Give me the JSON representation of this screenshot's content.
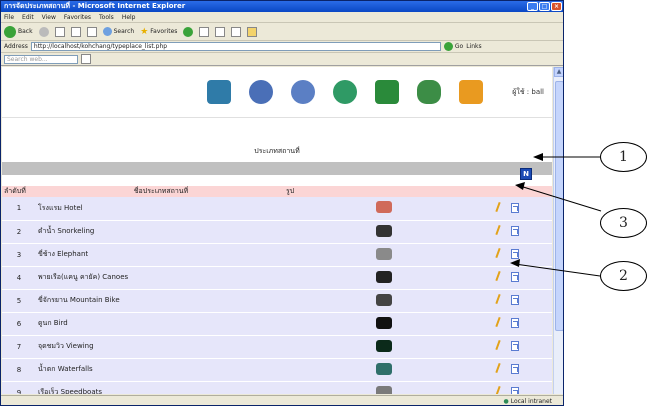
{
  "browser": {
    "title": "การจัดประเภทสถานที่ - Microsoft Internet Explorer",
    "menu": [
      "File",
      "Edit",
      "View",
      "Favorites",
      "Tools",
      "Help"
    ],
    "toolbar": {
      "back": "Back",
      "search": "Search",
      "favorites": "Favorites"
    },
    "address_label": "Address",
    "address": "http://localhost/kohchang/typeplace_list.php",
    "go_label": "Go",
    "links_label": "Links",
    "search_placeholder": "Search web...",
    "status_zone": "Local intranet"
  },
  "page": {
    "user_label": "ผู้ใช้ : ball",
    "heading": "ประเภทสถานที่",
    "new_button": "N",
    "columns": [
      "ลำดับที่",
      "ชื่อประเภทสถานที่",
      "รูป"
    ],
    "rows": [
      {
        "no": "1",
        "name": "โรงแรม Hotel",
        "img": "#d06a5a"
      },
      {
        "no": "2",
        "name": "ดำน้ำ Snorkeling",
        "img": "#333333"
      },
      {
        "no": "3",
        "name": "ขี่ช้าง Elephant",
        "img": "#8a8a8a"
      },
      {
        "no": "4",
        "name": "พายเรือ(แคนู คายัค) Canoes",
        "img": "#222222"
      },
      {
        "no": "5",
        "name": "ขี่จักรยาน Mountain Bike",
        "img": "#444444"
      },
      {
        "no": "6",
        "name": "ดูนก Bird",
        "img": "#111111"
      },
      {
        "no": "7",
        "name": "จุดชมวิว Viewing",
        "img": "#0b2a1a"
      },
      {
        "no": "8",
        "name": "น้ำตก Waterfalls",
        "img": "#2f6f6a"
      },
      {
        "no": "9",
        "name": "เรือเร็ว Speedboats",
        "img": "#7a7a7a"
      }
    ]
  },
  "callouts": [
    "1",
    "2",
    "3"
  ],
  "colors": {
    "ie_blue": "#0a47c4",
    "row_bg": "#e6e6fa",
    "header_bg": "#fbd5d5",
    "gray_bar": "#c0c0c0"
  }
}
